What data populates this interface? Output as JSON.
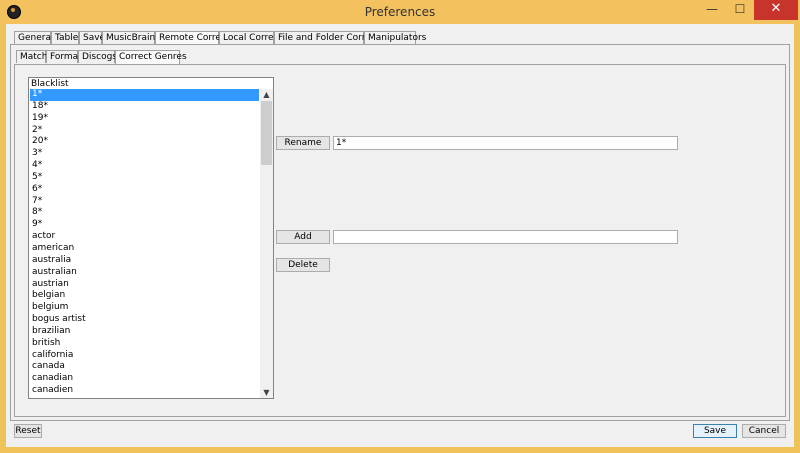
{
  "window": {
    "title": "Preferences",
    "minimize_glyph": "—",
    "maximize_glyph": "☐",
    "close_glyph": "✕"
  },
  "tabs": [
    "General",
    "Table",
    "Save",
    "MusicBrainz",
    "Remote Correct",
    "Local Correct",
    "File and Folder Correct",
    "Manipulators"
  ],
  "selected_tab": "Remote Correct",
  "subtabs": [
    "Match",
    "Format",
    "Discogs",
    "Correct Genres"
  ],
  "selected_subtab": "Correct Genres",
  "blacklist": {
    "header": "Blacklist",
    "selected_index": 0,
    "items": [
      "1*",
      "18*",
      "19*",
      "2*",
      "20*",
      "3*",
      "4*",
      "5*",
      "6*",
      "7*",
      "8*",
      "9*",
      "actor",
      "american",
      "australia",
      "australian",
      "austrian",
      "belgian",
      "belgium",
      "bogus artist",
      "brazilian",
      "british",
      "california",
      "canada",
      "canadian",
      "canadien"
    ]
  },
  "rename": {
    "button_label": "Rename",
    "value": "1*"
  },
  "add": {
    "button_label": "Add",
    "value": ""
  },
  "delete": {
    "button_label": "Delete"
  },
  "footer": {
    "reset_label": "Reset",
    "save_label": "Save",
    "cancel_label": "Cancel"
  },
  "colors": {
    "selection": "#3399ff",
    "titlebar": "#f3c15e",
    "close_button": "#c7342c"
  },
  "icons": {
    "scroll_up": "▲",
    "scroll_down": "▼",
    "app": "app-icon"
  }
}
